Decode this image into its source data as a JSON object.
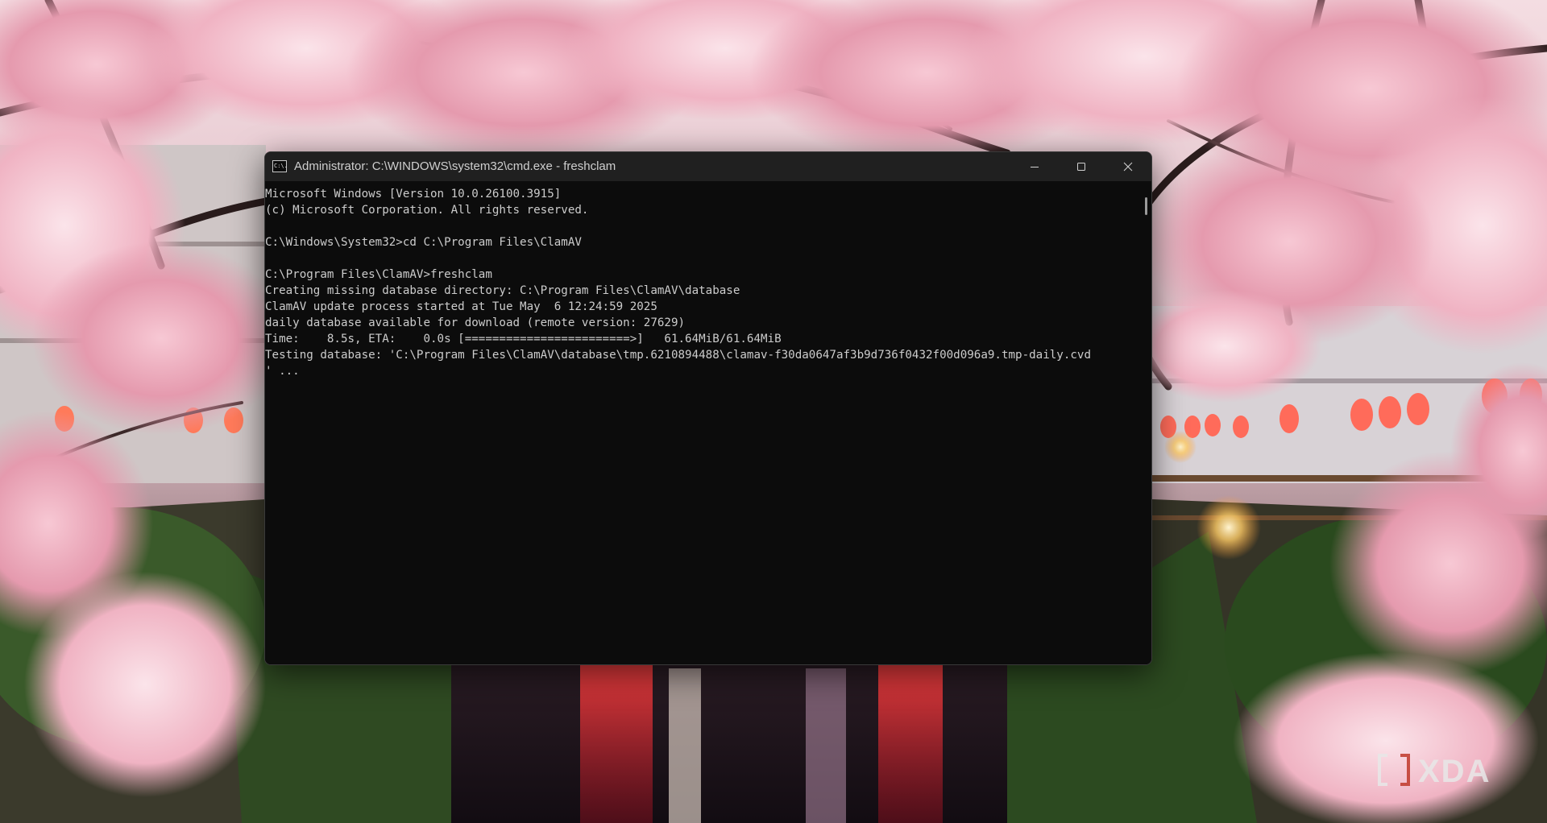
{
  "window": {
    "title": "Administrator: C:\\WINDOWS\\system32\\cmd.exe - freshclam",
    "icon": "cmd-icon",
    "icon_text": "C:\\."
  },
  "controls": {
    "minimize_icon": "minimize-icon",
    "maximize_icon": "maximize-icon",
    "close_icon": "close-icon"
  },
  "console": {
    "lines": [
      "Microsoft Windows [Version 10.0.26100.3915]",
      "(c) Microsoft Corporation. All rights reserved.",
      "",
      "C:\\Windows\\System32>cd C:\\Program Files\\ClamAV",
      "",
      "C:\\Program Files\\ClamAV>freshclam",
      "Creating missing database directory: C:\\Program Files\\ClamAV\\database",
      "ClamAV update process started at Tue May  6 12:24:59 2025",
      "daily database available for download (remote version: 27629)",
      "Time:    8.5s, ETA:    0.0s [========================>]   61.64MiB/61.64MiB",
      "Testing database: 'C:\\Program Files\\ClamAV\\database\\tmp.6210894488\\clamav-f30da0647af3b9d736f0432f00d096a9.tmp-daily.cvd",
      "' ..."
    ]
  },
  "watermark": {
    "text": "XDA",
    "logo": "xda-logo"
  },
  "colors": {
    "console_bg": "#0c0c0c",
    "console_text": "#cccccc",
    "titlebar_bg": "#202020",
    "title_text": "#cfcfcf"
  }
}
